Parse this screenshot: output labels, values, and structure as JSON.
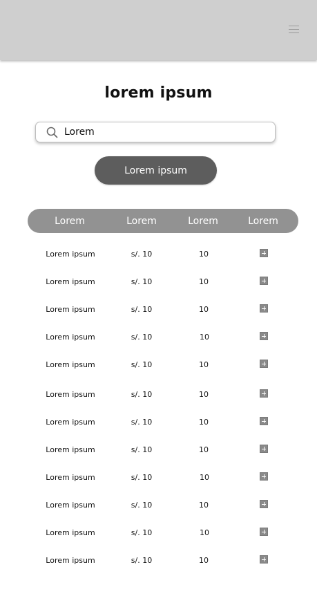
{
  "header": {
    "menu_icon": "hamburger-menu-icon"
  },
  "page": {
    "title": "lorem ipsum"
  },
  "search": {
    "value": "Lorem",
    "icon": "search-icon"
  },
  "actions": {
    "primary_label": "Lorem ipsum"
  },
  "table": {
    "columns": [
      "Lorem",
      "Lorem",
      "Lorem",
      "Lorem"
    ],
    "rows": [
      {
        "name": "Lorem ipsum",
        "price": "s/. 10",
        "qty": "10"
      },
      {
        "name": "Lorem ipsum",
        "price": "s/. 10",
        "qty": "10"
      },
      {
        "name": "Lorem ipsum",
        "price": "s/. 10",
        "qty": "10"
      },
      {
        "name": "Lorem ipsum",
        "price": "s/. 10",
        "qty": "10"
      },
      {
        "name": "Lorem ipsum",
        "price": "s/. 10",
        "qty": "10"
      },
      {
        "name": "Lorem ipsum",
        "price": "s/. 10",
        "qty": "10"
      },
      {
        "name": "Lorem ipsum",
        "price": "s/. 10",
        "qty": "10"
      },
      {
        "name": "Lorem ipsum",
        "price": "s/. 10",
        "qty": "10"
      },
      {
        "name": "Lorem ipsum",
        "price": "s/. 10",
        "qty": "10"
      },
      {
        "name": "Lorem ipsum",
        "price": "s/. 10",
        "qty": "10"
      },
      {
        "name": "Lorem ipsum",
        "price": "s/. 10",
        "qty": "10"
      },
      {
        "name": "Lorem ipsum",
        "price": "s/. 10",
        "qty": "10"
      }
    ],
    "row_action_icon": "plus-square-icon"
  },
  "colors": {
    "topbar": "#cfcfcf",
    "button": "#5d5d5d",
    "table_header": "#929292"
  }
}
